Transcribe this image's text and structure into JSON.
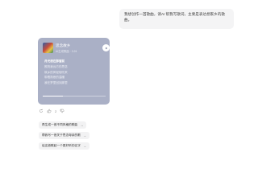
{
  "user_message": {
    "text": "我想创作一首歌曲，请AI 帮我写歌词，主要是表达想家乡的歌曲。"
  },
  "music_card": {
    "title": "思念故乡",
    "subtitle": "AI生成歌曲 · 3:24",
    "lyrics": [
      "月光洒在那窗前",
      "照亮我远方的思念",
      "故乡的风轻轻吹来",
      "带着熟悉的温暖",
      "我在梦里回到那里"
    ],
    "active_lyric_index": 0,
    "progress": 0.32
  },
  "actions": {
    "like_count": "2"
  },
  "suggestions": [
    {
      "label": "再生成一首不同风格的歌曲"
    },
    {
      "label": "帮我写一首关于思念母亲的歌"
    },
    {
      "label": "给这首歌起一个更好听的名字"
    }
  ]
}
